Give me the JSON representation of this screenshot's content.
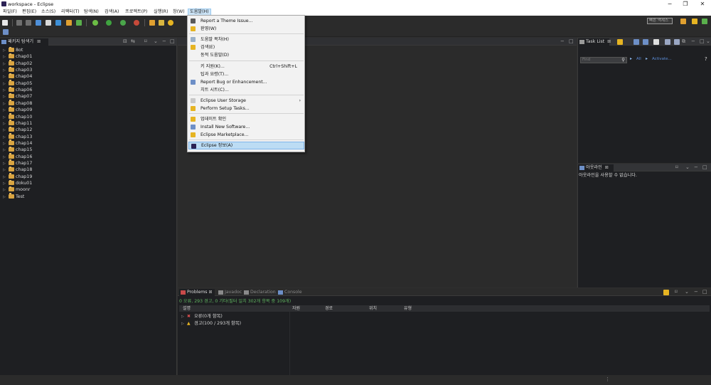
{
  "window": {
    "title": "workspace - Eclipse",
    "minimize": "−",
    "maximize": "❐",
    "close": "✕"
  },
  "menubar": [
    "파일(F)",
    "편집(E)",
    "소스(S)",
    "리팩터(T)",
    "탐색(N)",
    "검색(A)",
    "프로젝트(P)",
    "실행(R)",
    "창(W)",
    "도움말(H)"
  ],
  "toolbar": {
    "quick_access": "빠른 액세스"
  },
  "package_explorer": {
    "title": "패키지 탐색기",
    "items": [
      "8ot",
      "chap01",
      "chap02",
      "chap03",
      "chap04",
      "chap05",
      "chap06",
      "chap07",
      "chap08",
      "chap09",
      "chap10",
      "chap11",
      "chap12",
      "chap13",
      "chap14",
      "chap15",
      "chap16",
      "chap17",
      "chap18",
      "chap19",
      "doku01",
      "moonr",
      "Test"
    ]
  },
  "help_menu": {
    "items": [
      {
        "label": "Report a Theme Issue...",
        "icon": "bug-icon",
        "color": "#5a5a5a"
      },
      {
        "label": "환영(W)",
        "icon": "welcome-icon",
        "color": "#e6b422"
      },
      {
        "sep": true
      },
      {
        "label": "도움말 목차(H)",
        "icon": "help-icon",
        "color": "#9ab0c8"
      },
      {
        "label": "검색(E)",
        "icon": "search-icon",
        "color": "#e6b422"
      },
      {
        "label": "동적 도움말(D)",
        "icon": "",
        "color": ""
      },
      {
        "sep": true
      },
      {
        "label": "키 지원(K)...",
        "shortcut": "Ctrl+Shift+L",
        "icon": "",
        "color": ""
      },
      {
        "label": "팁과 요령(T)...",
        "icon": "",
        "color": ""
      },
      {
        "label": "Report Bug or Enhancement...",
        "icon": "report-bug-icon",
        "color": "#6d8fc7"
      },
      {
        "label": "치트 시트(C)...",
        "icon": "",
        "color": ""
      },
      {
        "sep": true
      },
      {
        "label": "Eclipse User Storage",
        "icon": "user-storage-icon",
        "color": "#c8c8c8",
        "submenu": true
      },
      {
        "label": "Perform Setup Tasks...",
        "icon": "setup-tasks-icon",
        "color": "#e6b422"
      },
      {
        "sep": true
      },
      {
        "label": "업데이트 확인",
        "icon": "update-icon",
        "color": "#e6b422"
      },
      {
        "label": "Install New Software...",
        "icon": "install-icon",
        "color": "#6d8fc7"
      },
      {
        "label": "Eclipse Marketplace...",
        "icon": "marketplace-icon",
        "color": "#e6b422"
      },
      {
        "sep": true
      },
      {
        "label": "Eclipse 정보(A)",
        "icon": "eclipse-about-icon",
        "color": "#2c2255",
        "selected": true
      }
    ]
  },
  "task_list": {
    "title": "Task List",
    "find_placeholder": "Find",
    "all_label": "All",
    "activate_label": "Activate..."
  },
  "outline": {
    "title": "아웃라인",
    "message": "아웃라인을 사용할 수 없습니다."
  },
  "bottom_tabs": [
    {
      "label": "Problems",
      "icon": "problems-icon",
      "color": "#c84a4a"
    },
    {
      "label": "Javadoc",
      "icon": "javadoc-icon",
      "color": "#8a8a8a"
    },
    {
      "label": "Declaration",
      "icon": "declaration-icon",
      "color": "#8a8a8a"
    },
    {
      "label": "Console",
      "icon": "console-icon",
      "color": "#6d8fc7"
    }
  ],
  "problems": {
    "summary": "0 오류, 293 경고, 0 기타(필터 일치 302개 항목 중 109개)",
    "columns": [
      "설명",
      "자원",
      "경로",
      "위치",
      "유형"
    ],
    "rows": [
      {
        "icon": "error-icon",
        "label": "오류(0개 항목)"
      },
      {
        "icon": "warning-icon",
        "label": "경고(100 / 293개 항목)"
      }
    ]
  },
  "colors": {
    "summary_text": "#5fb35f",
    "accent": "#3a86d8"
  }
}
